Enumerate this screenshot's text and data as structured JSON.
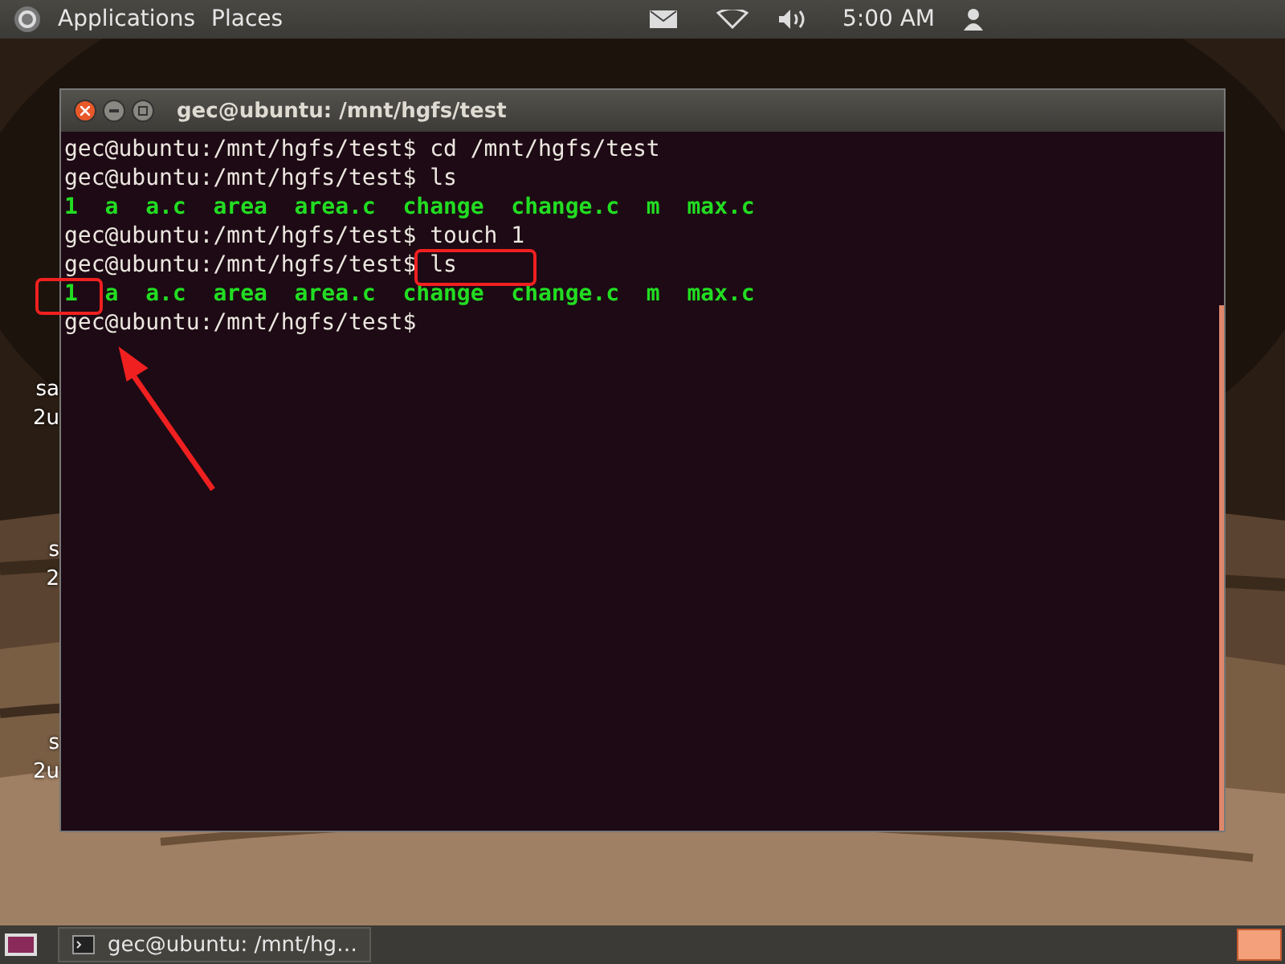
{
  "top_panel": {
    "menus": [
      "Applications",
      "Places"
    ],
    "clock": "5:00 AM"
  },
  "desktop_labels": [
    {
      "lines": [
        "sa",
        "2u"
      ]
    },
    {
      "lines": [
        "s",
        "2"
      ]
    },
    {
      "lines": [
        "s",
        "2u"
      ]
    }
  ],
  "terminal": {
    "title": "gec@ubuntu: /mnt/hgfs/test",
    "lines": [
      {
        "kind": "prompt",
        "prompt": "gec@ubuntu:/mnt/hgfs/test$",
        "command": "cd /mnt/hgfs/test"
      },
      {
        "kind": "prompt",
        "prompt": "gec@ubuntu:/mnt/hgfs/test$",
        "command": "ls"
      },
      {
        "kind": "output",
        "text": "1  a  a.c  area  area.c  change  change.c  m  max.c"
      },
      {
        "kind": "prompt",
        "prompt": "gec@ubuntu:/mnt/hgfs/test$",
        "command": "touch 1"
      },
      {
        "kind": "prompt",
        "prompt": "gec@ubuntu:/mnt/hgfs/test$",
        "command": "ls"
      },
      {
        "kind": "output",
        "text": "1  a  a.c  area  area.c  change  change.c  m  max.c"
      },
      {
        "kind": "prompt",
        "prompt": "gec@ubuntu:/mnt/hgfs/test$"
      }
    ]
  },
  "taskbar": {
    "items": [
      {
        "label": "gec@ubuntu: /mnt/hg…",
        "selected": false
      }
    ]
  }
}
